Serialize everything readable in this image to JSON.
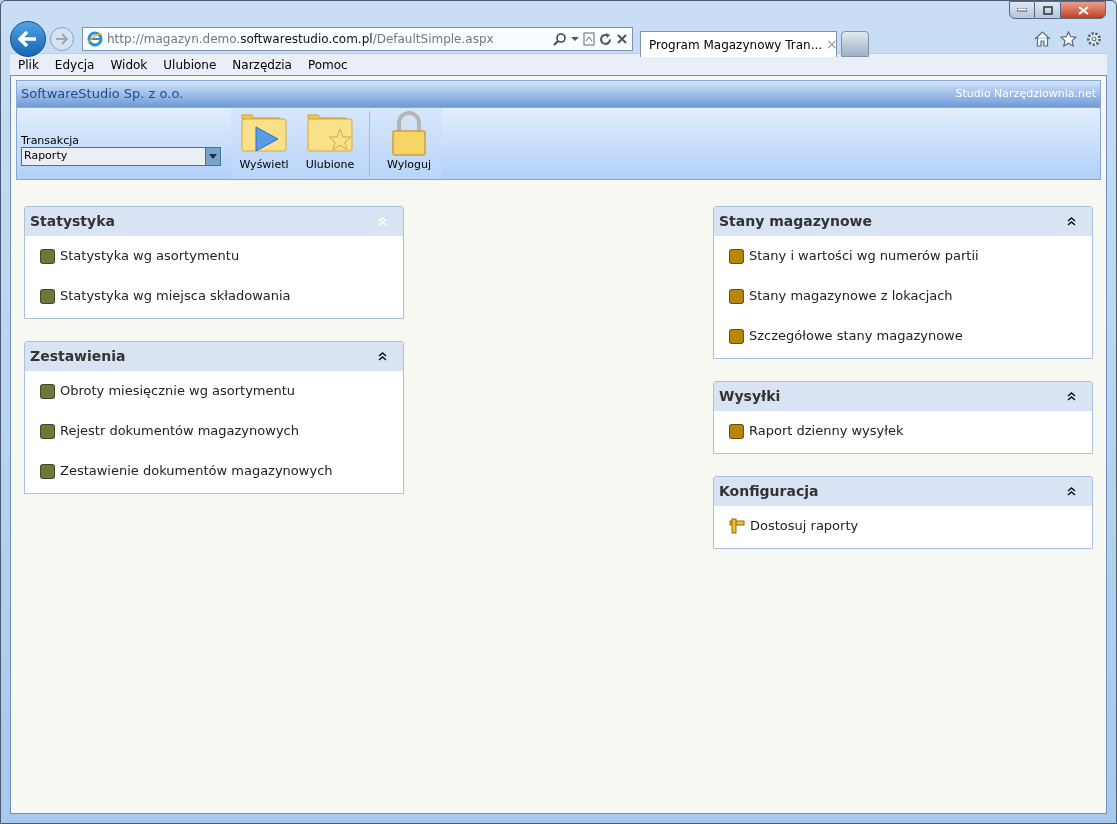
{
  "browser": {
    "url": {
      "prefix": "http://magazyn.demo.",
      "domain": "softwarestudio.com.pl",
      "suffix": "/DefaultSimple.aspx"
    },
    "tabs": [
      {
        "title": "Program Magazynowy Tran...",
        "close": "×",
        "selected": true
      }
    ],
    "menu": [
      "Plik",
      "Edycja",
      "Widok",
      "Ulubione",
      "Narzędzia",
      "Pomoc"
    ]
  },
  "app": {
    "company": "SoftwareStudio Sp. z o.o.",
    "brand": "Studio Narzędziownia.net",
    "transaction": {
      "label": "Transakcja",
      "value": "Raporty"
    },
    "toolbar": [
      {
        "kind": "play-folder",
        "label": "Wyświetl"
      },
      {
        "kind": "star-folder",
        "label": "Ulubione"
      },
      {
        "kind": "lock",
        "label": "Wyloguj"
      }
    ]
  },
  "columns": [
    [
      {
        "title": "Statystyka",
        "highlighted": true,
        "items": [
          {
            "kind": "square",
            "color": "#6b7a3a",
            "label": "Statystyka wg asortymentu"
          },
          {
            "kind": "square",
            "color": "#6b7a3a",
            "label": "Statystyka wg miejsca składowania"
          }
        ]
      },
      {
        "title": "Zestawienia",
        "highlighted": false,
        "items": [
          {
            "kind": "square",
            "color": "#6b7a3a",
            "label": "Obroty miesięcznie wg asortymentu"
          },
          {
            "kind": "square",
            "color": "#6b7a3a",
            "label": "Rejestr dokumentów magazynowych"
          },
          {
            "kind": "square",
            "color": "#6b7a3a",
            "label": "Zestawienie dokumentów magazynowych"
          }
        ]
      }
    ],
    [
      {
        "title": "Stany magazynowe",
        "highlighted": false,
        "items": [
          {
            "kind": "square",
            "color": "#b8860b",
            "label": "Stany i wartości wg numerów partii"
          },
          {
            "kind": "square",
            "color": "#b8860b",
            "label": "Stany magazynowe z lokacjach"
          },
          {
            "kind": "square",
            "color": "#b8860b",
            "label": "Szczegółowe stany magazynowe"
          }
        ]
      },
      {
        "title": "Wysyłki",
        "highlighted": false,
        "items": [
          {
            "kind": "square",
            "color": "#b8860b",
            "label": "Raport dzienny wysyłek"
          }
        ]
      },
      {
        "title": "Konfiguracja",
        "highlighted": false,
        "items": [
          {
            "kind": "tool",
            "label": "Dostosuj raporty"
          }
        ]
      }
    ]
  ]
}
